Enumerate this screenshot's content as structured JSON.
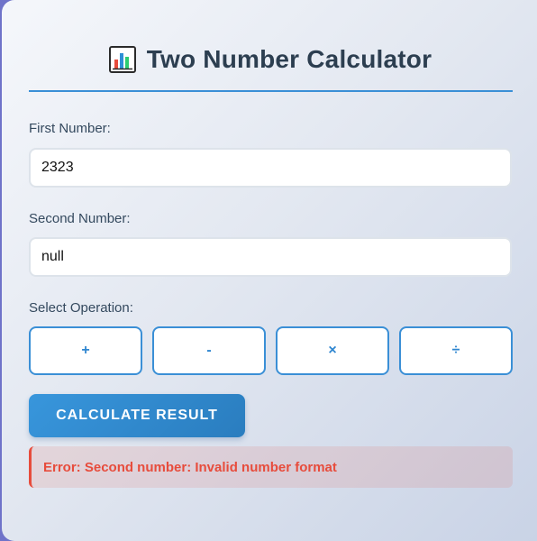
{
  "header": {
    "title": "Two Number Calculator",
    "icon": "bar-chart-icon"
  },
  "form": {
    "first_label": "First Number:",
    "first_value": "2323",
    "second_label": "Second Number:",
    "second_value": "null",
    "operation_label": "Select Operation:"
  },
  "operations": [
    {
      "symbol": "+"
    },
    {
      "symbol": "-"
    },
    {
      "symbol": "×"
    },
    {
      "symbol": "÷"
    }
  ],
  "actions": {
    "calculate_label": "CALCULATE RESULT"
  },
  "result": {
    "error_message": "Error: Second number: Invalid number format"
  },
  "colors": {
    "accent": "#3a8fd6",
    "title": "#2c3e50",
    "error": "#e74c3c"
  }
}
